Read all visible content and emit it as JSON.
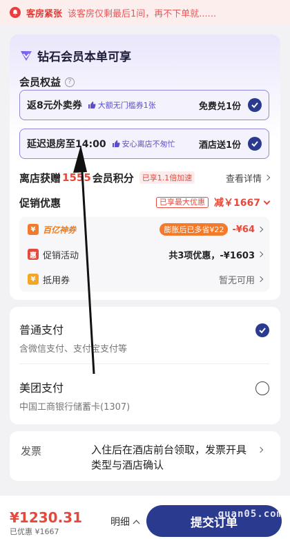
{
  "alert": {
    "label": "客房紧张",
    "message": "该客房仅剩最后1间，再不下单就......"
  },
  "member_card": {
    "title": "钻石会员本单可享",
    "rights_label": "会员权益",
    "help_glyph": "?",
    "benefits": [
      {
        "text": "返8元外卖券",
        "tag": "大额无门槛券1张",
        "right": "免费兑1份",
        "checked": true
      },
      {
        "text": "延迟退房至14:00",
        "tag": "安心离店不匆忙",
        "right": "酒店送1份",
        "checked": true
      }
    ],
    "points": {
      "prefix": "离店获赠",
      "value": "1555",
      "suffix": "会员积分",
      "accelerate_tag": "已享1.1倍加速",
      "detail_link": "查看详情"
    },
    "promo": {
      "title": "促销优惠",
      "max_tag": "已享最大优惠",
      "discount": "减￥1667",
      "lines": [
        {
          "icon": "¥",
          "label": "百亿神券",
          "pill": "膨胀后已多省¥22",
          "value": "-¥64"
        },
        {
          "icon": "惠",
          "label": "促销活动",
          "value": "共3项优惠，-¥1603"
        },
        {
          "icon": "¥",
          "label": "抵用券",
          "value": "暂无可用"
        }
      ]
    }
  },
  "payment": {
    "options": [
      {
        "name": "普通支付",
        "sub": "含微信支付、支付宝支付等",
        "selected": true
      },
      {
        "name": "美团支付",
        "sub": "中国工商银行储蓄卡(1307)",
        "selected": false
      }
    ]
  },
  "invoice": {
    "label": "发票",
    "value": "入住后在酒店前台领取，发票开具类型与酒店确认"
  },
  "bottom_bar": {
    "price": "¥1230.31",
    "saved": "已优惠 ¥1667",
    "detail": "明细",
    "submit": "提交订单",
    "watermark": "guan05.com"
  },
  "colors": {
    "accent": "#2a3a8f",
    "red": "#e5493c",
    "purple_border": "#8f8ad6"
  }
}
